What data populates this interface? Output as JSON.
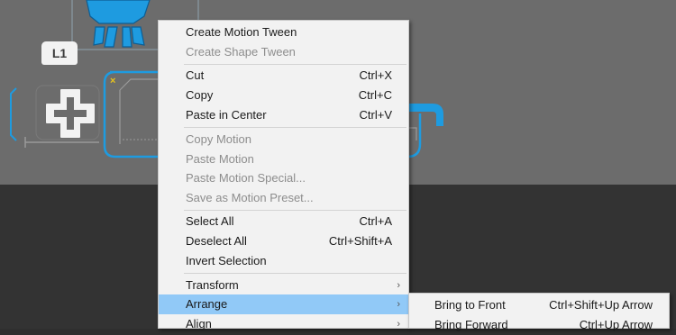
{
  "stage": {
    "layer_badge": "L1",
    "colors": {
      "stage_bg": "#6c6c6c",
      "pasteboard_bg": "#333333",
      "accent_blue": "#1e9be0",
      "marker_yellow": "#e8c31c",
      "highlight": "#91c9f7"
    }
  },
  "context_menu": {
    "create_motion_tween": "Create Motion Tween",
    "create_shape_tween": "Create Shape Tween",
    "cut": "Cut",
    "cut_sc": "Ctrl+X",
    "copy": "Copy",
    "copy_sc": "Ctrl+C",
    "paste_in_center": "Paste in Center",
    "paste_in_center_sc": "Ctrl+V",
    "copy_motion": "Copy Motion",
    "paste_motion": "Paste Motion",
    "paste_motion_special": "Paste Motion Special...",
    "save_motion_preset": "Save as Motion Preset...",
    "select_all": "Select All",
    "select_all_sc": "Ctrl+A",
    "deselect_all": "Deselect All",
    "deselect_all_sc": "Ctrl+Shift+A",
    "invert_selection": "Invert Selection",
    "transform": "Transform",
    "arrange": "Arrange",
    "align": "Align",
    "submenu_arrow": "›"
  },
  "arrange_submenu": {
    "bring_to_front": "Bring to Front",
    "bring_to_front_sc": "Ctrl+Shift+Up Arrow",
    "bring_forward": "Bring Forward",
    "bring_forward_sc": "Ctrl+Up Arrow"
  }
}
